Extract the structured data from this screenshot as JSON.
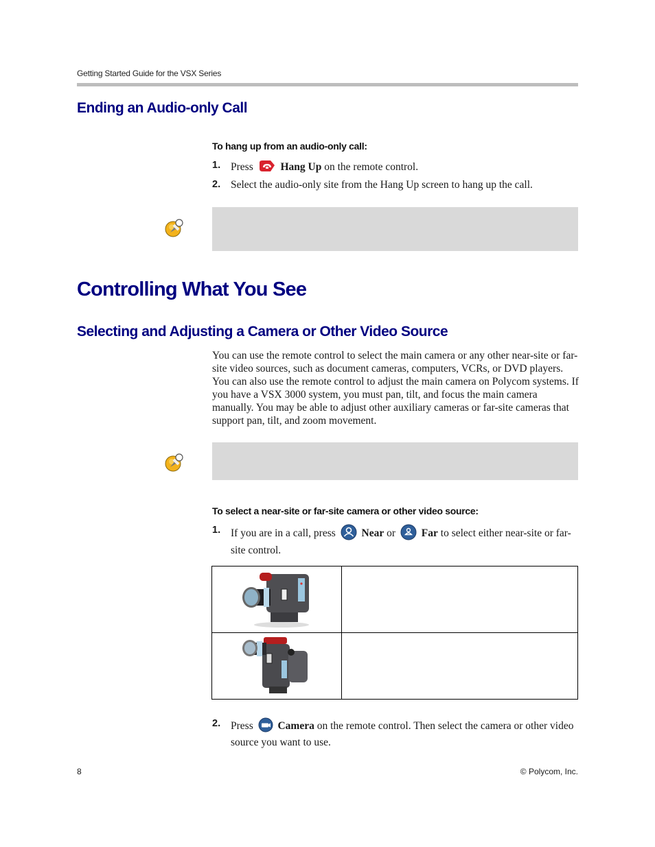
{
  "header": {
    "running_title": "Getting Started Guide for the VSX Series"
  },
  "section_ending": {
    "heading": "Ending an Audio-only Call",
    "procedure_title": "To hang up from an audio-only call:",
    "steps": [
      {
        "number": "1.",
        "pre": "Press",
        "icon": "hang-up-icon",
        "bold": "Hang Up",
        "post": "on the remote control."
      },
      {
        "number": "2.",
        "text": "Select the audio-only site from the Hang Up screen to hang up the call."
      }
    ],
    "note": {
      "icon": "note-pin-icon",
      "text": ""
    }
  },
  "chapter": {
    "heading": "Controlling What You See"
  },
  "section_selecting": {
    "heading": "Selecting and Adjusting a Camera or Other Video Source",
    "paragraph": "You can use the remote control to select the main camera or any other near-site or far-site video sources, such as document cameras, computers, VCRs, or DVD players. You can also use the remote control to adjust the main camera on Polycom systems. If you have a VSX 3000 system, you must pan, tilt, and focus the main camera manually. You may be able to adjust other auxiliary cameras or far-site cameras that support pan, tilt, and zoom movement.",
    "note": {
      "icon": "note-pin-icon",
      "text": ""
    },
    "procedure_title": "To select a near-site or far-site camera or other video source:",
    "step1": {
      "number": "1.",
      "pre": "If you are in a call, press",
      "near_icon": "near-icon",
      "near_bold": "Near",
      "mid": "or",
      "far_icon": "far-icon",
      "far_bold": "Far",
      "post": "to select either near-site or far-site control."
    },
    "camera_table": [
      {
        "image": "near-camera-icon",
        "description": ""
      },
      {
        "image": "far-camera-icon",
        "description": ""
      }
    ],
    "step2": {
      "number": "2.",
      "pre": "Press",
      "icon": "camera-button-icon",
      "bold": "Camera",
      "post": "on the remote control. Then select the camera or other video source you want to use."
    }
  },
  "footer": {
    "page_number": "8",
    "copyright": "© Polycom, Inc."
  },
  "colors": {
    "heading": "#000080",
    "header_rule": "#bdbdbd",
    "note_box": "#d9d9d9",
    "hang_up_red": "#d9232e",
    "remote_button_blue": "#2f5f9a"
  }
}
